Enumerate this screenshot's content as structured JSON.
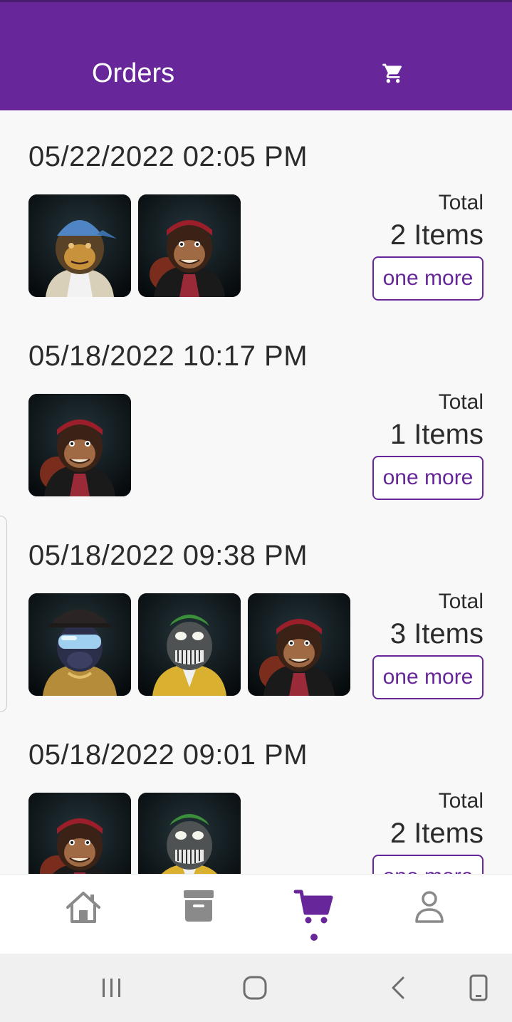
{
  "header": {
    "title": "Orders",
    "cart_icon": "cart-icon"
  },
  "colors": {
    "brand": "#67279a",
    "background": "#f8f8f8",
    "text": "#2b2b2b"
  },
  "orders": [
    {
      "date": "05/22/2022 02:05 PM",
      "total_label": "Total",
      "items_text": "2 Items",
      "button_label": "one more",
      "thumbnails": [
        "ape-blue-cap",
        "ape-red-bandana"
      ]
    },
    {
      "date": "05/18/2022 10:17 PM",
      "total_label": "Total",
      "items_text": "1 Items",
      "button_label": "one more",
      "thumbnails": [
        "ape-red-bandana"
      ]
    },
    {
      "date": "05/18/2022 09:38 PM",
      "total_label": "Total",
      "items_text": "3 Items",
      "button_label": "one more",
      "thumbnails": [
        "ape-goggles-gold",
        "ape-zombie-yellow",
        "ape-red-bandana"
      ]
    },
    {
      "date": "05/18/2022 09:01 PM",
      "total_label": "Total",
      "items_text": "2 Items",
      "button_label": "one more",
      "thumbnails": [
        "ape-red-bandana",
        "ape-zombie-yellow"
      ]
    }
  ],
  "bottom_nav": {
    "items": [
      {
        "icon": "home-icon"
      },
      {
        "icon": "archive-icon"
      },
      {
        "icon": "cart-icon",
        "active": true
      },
      {
        "icon": "user-icon"
      }
    ]
  },
  "system_nav": [
    "recents-icon",
    "home-circle-icon",
    "back-icon",
    "rotate-icon"
  ]
}
